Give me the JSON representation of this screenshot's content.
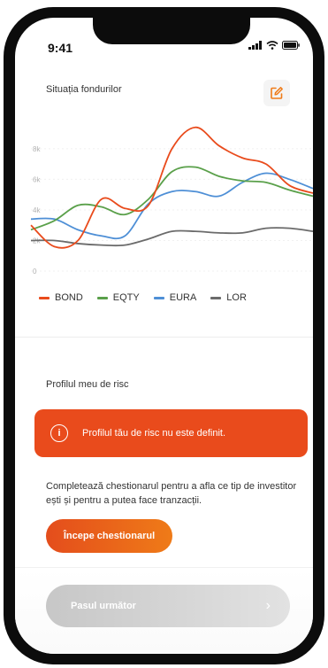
{
  "status_bar": {
    "time": "9:41"
  },
  "header": {
    "title": "Situația fondurilor",
    "edit_icon": "edit-icon"
  },
  "chart_data": {
    "type": "line",
    "x": [
      0,
      1,
      2,
      3,
      4,
      5,
      6,
      7,
      8,
      9,
      10,
      11,
      12
    ],
    "ylim": [
      0,
      9500
    ],
    "yticks": [
      0,
      2000,
      4000,
      6000,
      8000
    ],
    "yticklabels": [
      "0",
      "2k",
      "4k",
      "6k",
      "8k"
    ],
    "series": [
      {
        "name": "BOND",
        "color": "#e94b1c",
        "values": [
          3000,
          1600,
          2000,
          4700,
          4100,
          4300,
          8000,
          9400,
          8200,
          7400,
          7000,
          5600,
          5100
        ]
      },
      {
        "name": "EQTY",
        "color": "#5aa04a",
        "values": [
          2700,
          3300,
          4300,
          4200,
          3700,
          4700,
          6500,
          6800,
          6200,
          5900,
          5800,
          5300,
          4900
        ]
      },
      {
        "name": "EURA",
        "color": "#4e8fd6",
        "values": [
          3400,
          3400,
          2700,
          2300,
          2300,
          4400,
          5200,
          5200,
          4900,
          5800,
          6400,
          6000,
          5400
        ]
      },
      {
        "name": "LOR",
        "color": "#6b6b6b",
        "values": [
          2000,
          2000,
          1800,
          1700,
          1700,
          2100,
          2600,
          2600,
          2500,
          2500,
          2800,
          2800,
          2600
        ]
      }
    ]
  },
  "risk": {
    "title": "Profilul meu de risc",
    "alert_text": "Profilul tău de risc nu este definit.",
    "description": "Completează chestionarul pentru a afla ce tip de investitor ești și pentru a putea face tranzacții.",
    "start_label": "Începe chestionarul"
  },
  "footer": {
    "next_label": "Pasul următor"
  }
}
